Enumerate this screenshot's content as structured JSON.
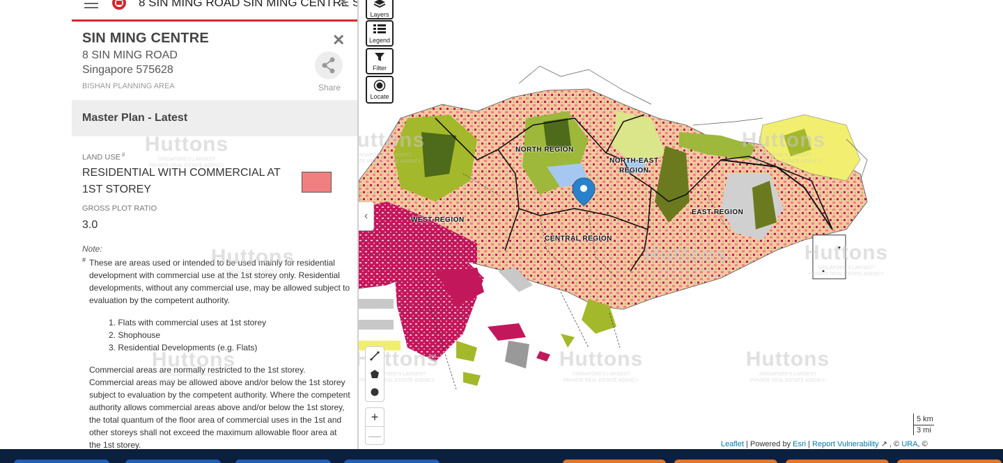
{
  "topbar": {
    "search_text": "8 SIN MING ROAD SIN MING CENTRE S",
    "clear_symbol": "✕"
  },
  "place": {
    "name": "SIN MING CENTRE",
    "address_line1": "8 SIN MING ROAD",
    "address_line2": "Singapore 575628",
    "planning_area": "BISHAN PLANNING AREA",
    "close_symbol": "✕",
    "share_label": "Share"
  },
  "section": {
    "title": "Master Plan - Latest"
  },
  "land_use": {
    "label": "LAND USE",
    "label_mark": "#",
    "value": "RESIDENTIAL WITH COMMERCIAL AT 1ST STOREY",
    "color": "#f08080"
  },
  "plot_ratio": {
    "label": "GROSS PLOT RATIO",
    "value": "3.0"
  },
  "note": {
    "label": "Note:",
    "mark": "#",
    "body": "These are areas used or intended to be used mainly for residential development with commercial use at the 1st storey only. Residential developments, without any commercial use, may be allowed subject to evaluation by the competent authority.",
    "items": [
      "1. Flats with commercial uses at 1st storey",
      "2. Shophouse",
      "3. Residential Developments (e.g. Flats)"
    ],
    "paragraph": "Commercial areas are normally restricted to the 1st storey. Commercial areas may be allowed above and/or below the 1st storey subject to evaluation by the competent authority. Where the competent authority allows commercial areas above and/or below the 1st storey, the total quantum of the floor area of commercial uses in the 1st and other storeys shall not exceed the maximum allowable floor area at the 1st storey."
  },
  "map_controls": {
    "layers": "Layers",
    "legend": "Legend",
    "filter": "Filter",
    "locate": "Locate",
    "collapse_symbol": "‹",
    "zoom_in": "+",
    "zoom_out": "—"
  },
  "regions": {
    "north": "NORTH REGION",
    "north_east_1": "NORTH-EAST",
    "north_east_2": "REGION",
    "east": "EAST REGION",
    "west": "WEST REGION",
    "central": "CENTRAL REGION"
  },
  "watermark": {
    "brand": "Huttons",
    "tag1": "SINGAPORE'S LARGEST",
    "tag2": "PRIVATE REAL ESTATE AGENCY"
  },
  "scale": {
    "km": "5 km",
    "mi": "3 mi"
  },
  "attribution": {
    "leaflet": "Leaflet",
    "sep1": " | Powered by ",
    "esri": "Esri",
    "sep2": " | ",
    "report": "Report Vulnerability",
    "ext_icon": "↗",
    "copyright": " , © ",
    "ura": "URA",
    "tail": ", ©"
  },
  "colors": {
    "accent_red": "#d6262f",
    "residential": "#f5c8a0",
    "commercial_res": "#f08080",
    "industrial": "#c2185b",
    "park": "#c8e6a0",
    "nature": "#6b7a1e",
    "reserve": "#f2ef70",
    "water": "#a6c8f0",
    "taskbar": "#0b1f3f"
  }
}
